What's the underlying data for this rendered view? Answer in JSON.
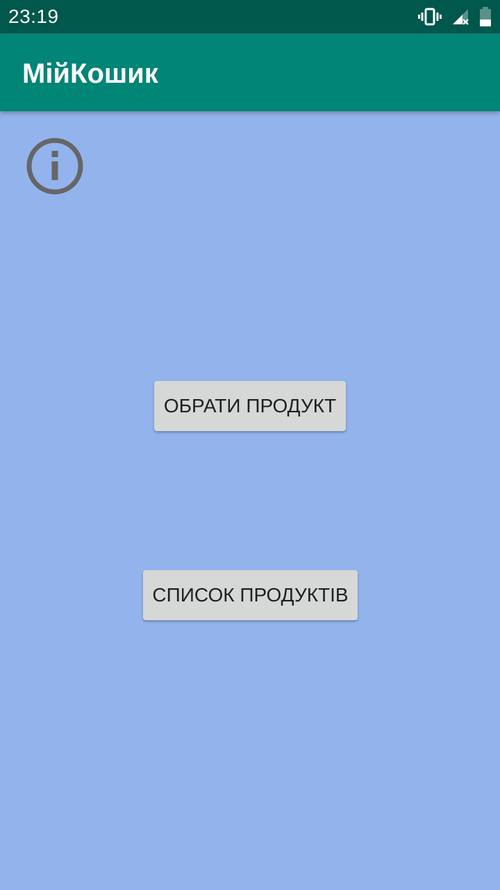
{
  "status_bar": {
    "time": "23:19",
    "icons": [
      "vibrate-icon",
      "signal-icon",
      "battery-icon"
    ]
  },
  "app_bar": {
    "title": "МійКошик"
  },
  "main": {
    "info_icon": "info-icon",
    "choose_product_label": "ОБРАТИ ПРОДУКТ",
    "product_list_label": "СПИСОК ПРОДУКТІВ"
  },
  "colors": {
    "status_bar": "#00574b",
    "app_bar": "#008577",
    "background": "#93b3ec",
    "button": "#d6d7d7",
    "button_text": "#1f1f1f",
    "icon": "#666666"
  }
}
